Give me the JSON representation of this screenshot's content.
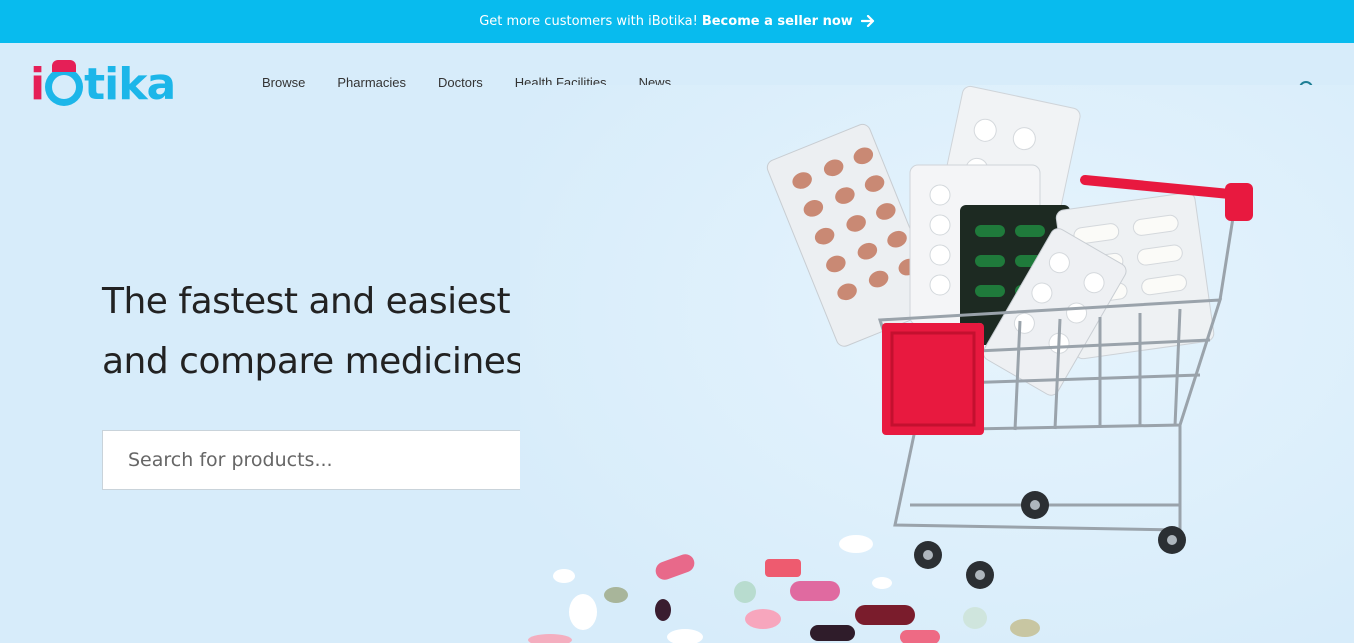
{
  "announcement": {
    "text": "Get more customers with iBotika!",
    "cta_label": "Become a seller now",
    "arrow_icon": "arrow-right-icon"
  },
  "brand": {
    "logo_text_i": "i",
    "logo_text_b": "B",
    "logo_text_rest": "tika",
    "colors": {
      "primary": "#1cb6e9",
      "accent": "#e51f57",
      "banner": "#08bbee",
      "search_button": "#f5154e",
      "background": "#d7ecfa"
    }
  },
  "nav": {
    "items": [
      {
        "label": "Browse"
      },
      {
        "label": "Pharmacies"
      },
      {
        "label": "Doctors"
      },
      {
        "label": "Health Facilities"
      },
      {
        "label": "News"
      }
    ],
    "account_icon": "user-icon"
  },
  "hero": {
    "title_line1": "The fastest and easiest way to find",
    "title_line2": "and compare medicines near you."
  },
  "search": {
    "placeholder": "Search for products...",
    "value": "",
    "button_icon": "search-icon"
  },
  "illustration": {
    "subject": "shopping-cart-with-medicine-blister-packs-and-pills-icon"
  }
}
